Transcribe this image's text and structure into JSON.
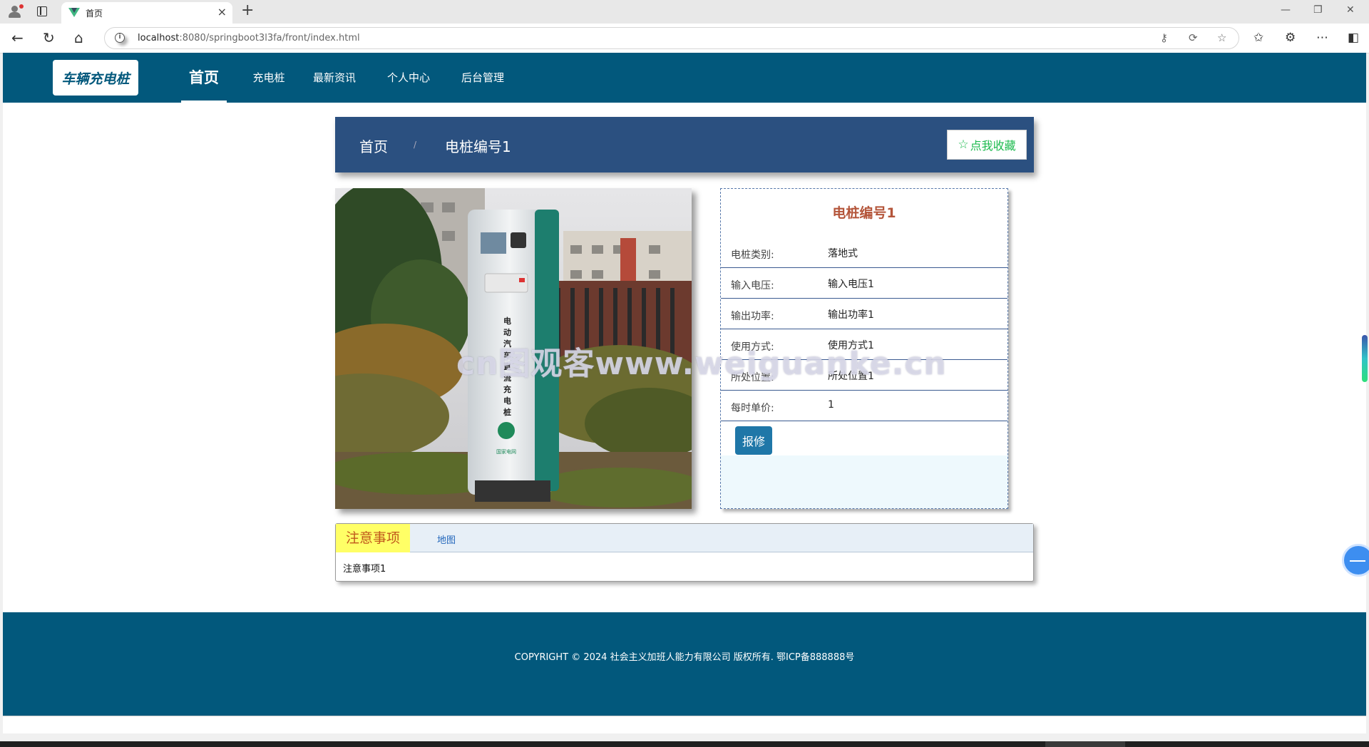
{
  "browser": {
    "tab_title": "首页",
    "url_host": "localhost",
    "url_rest": ":8080/springboot3l3fa/front/index.html"
  },
  "site": {
    "logo": "车辆充电桩",
    "nav": [
      {
        "label": "首页",
        "active": true
      },
      {
        "label": "充电桩",
        "active": false
      },
      {
        "label": "最新资讯",
        "active": false
      },
      {
        "label": "个人中心",
        "active": false
      },
      {
        "label": "后台管理",
        "active": false
      }
    ]
  },
  "breadcrumb": {
    "home": "首页",
    "separator": "/",
    "current": "电桩编号1",
    "favorite_label": "点我收藏"
  },
  "detail": {
    "title": "电桩编号1",
    "fields": [
      {
        "key": "电桩类别:",
        "value": "落地式"
      },
      {
        "key": "输入电压:",
        "value": "输入电压1"
      },
      {
        "key": "输出功率:",
        "value": "输出功率1"
      },
      {
        "key": "使用方式:",
        "value": "使用方式1"
      },
      {
        "key": "所处位置:",
        "value": "所处位置1"
      },
      {
        "key": "每时单价:",
        "value": "1"
      }
    ],
    "repair_label": "报修"
  },
  "photo": {
    "pole_text": "电动汽车直流充电桩"
  },
  "tabs": {
    "items": [
      {
        "label": "注意事项",
        "active": true
      },
      {
        "label": "地图",
        "active": false
      }
    ],
    "content": "注意事项1"
  },
  "watermark": "cn图观客www.weiguanke.cn",
  "footer": {
    "copyright": "COPYRIGHT © 2024 社会主义加班人能力有限公司 版权所有. 鄂ICP备888888号"
  },
  "colors": {
    "header_bg": "#02587c",
    "crumb_bg": "#2b5080",
    "detail_title": "#b4553a",
    "favorite_text": "#1dbb4f",
    "repair_bg": "#1f77a8",
    "tab_active_bg": "#ffff66"
  }
}
